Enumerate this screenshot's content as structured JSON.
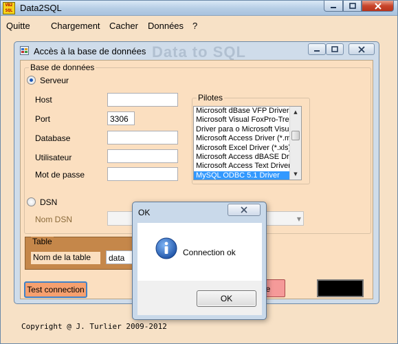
{
  "app": {
    "title": "Data2SQL",
    "icon_text": "VB2 SQL"
  },
  "menu": [
    "Quitte",
    "Chargement",
    "Cacher",
    "Données",
    "?"
  ],
  "inner_window": {
    "title": "Accès à la base de données",
    "ghost_title": "Data to SQL"
  },
  "db_group": {
    "legend": "Base de données",
    "server_radio": "Serveur",
    "server_selected": true,
    "fields": {
      "host_label": "Host",
      "host_value": "",
      "port_label": "Port",
      "port_value": "3306",
      "database_label": "Database",
      "database_value": "",
      "user_label": "Utilisateur",
      "user_value": "",
      "password_label": "Mot de passe",
      "password_value": ""
    },
    "dsn_radio": "DSN",
    "dsn_selected": false,
    "dsn_name_label": "Nom DSN",
    "dsn_value": ""
  },
  "drivers": {
    "legend": "Pilotes",
    "items": [
      "Microsoft dBase VFP Driver (*.dbf)",
      "Microsoft Visual FoxPro-Treiber",
      "Driver para o Microsoft Visual FoxPro",
      "Microsoft Access Driver (*.mdb)",
      "Microsoft Excel Driver (*.xls)",
      "Microsoft Access dBASE Driver",
      "Microsoft Access Text Driver",
      "MySQL ODBC 5.1 Driver"
    ],
    "selected": "MySQL ODBC 5.1 Driver"
  },
  "table_group": {
    "legend": "Table",
    "name_label": "Nom de la table",
    "name_value": "data"
  },
  "buttons": {
    "test_connection": "Test connection",
    "partial_button": "le"
  },
  "copyright": "Copyright @  J. Turlier 2009-2012",
  "dialog": {
    "title": "OK",
    "message": "Connection ok",
    "ok_button": "OK"
  },
  "colors": {
    "client_bg": "#fbdfc0",
    "selection": "#3399ff",
    "test_button": "#f6a06f",
    "table_group": "#c5874a"
  }
}
